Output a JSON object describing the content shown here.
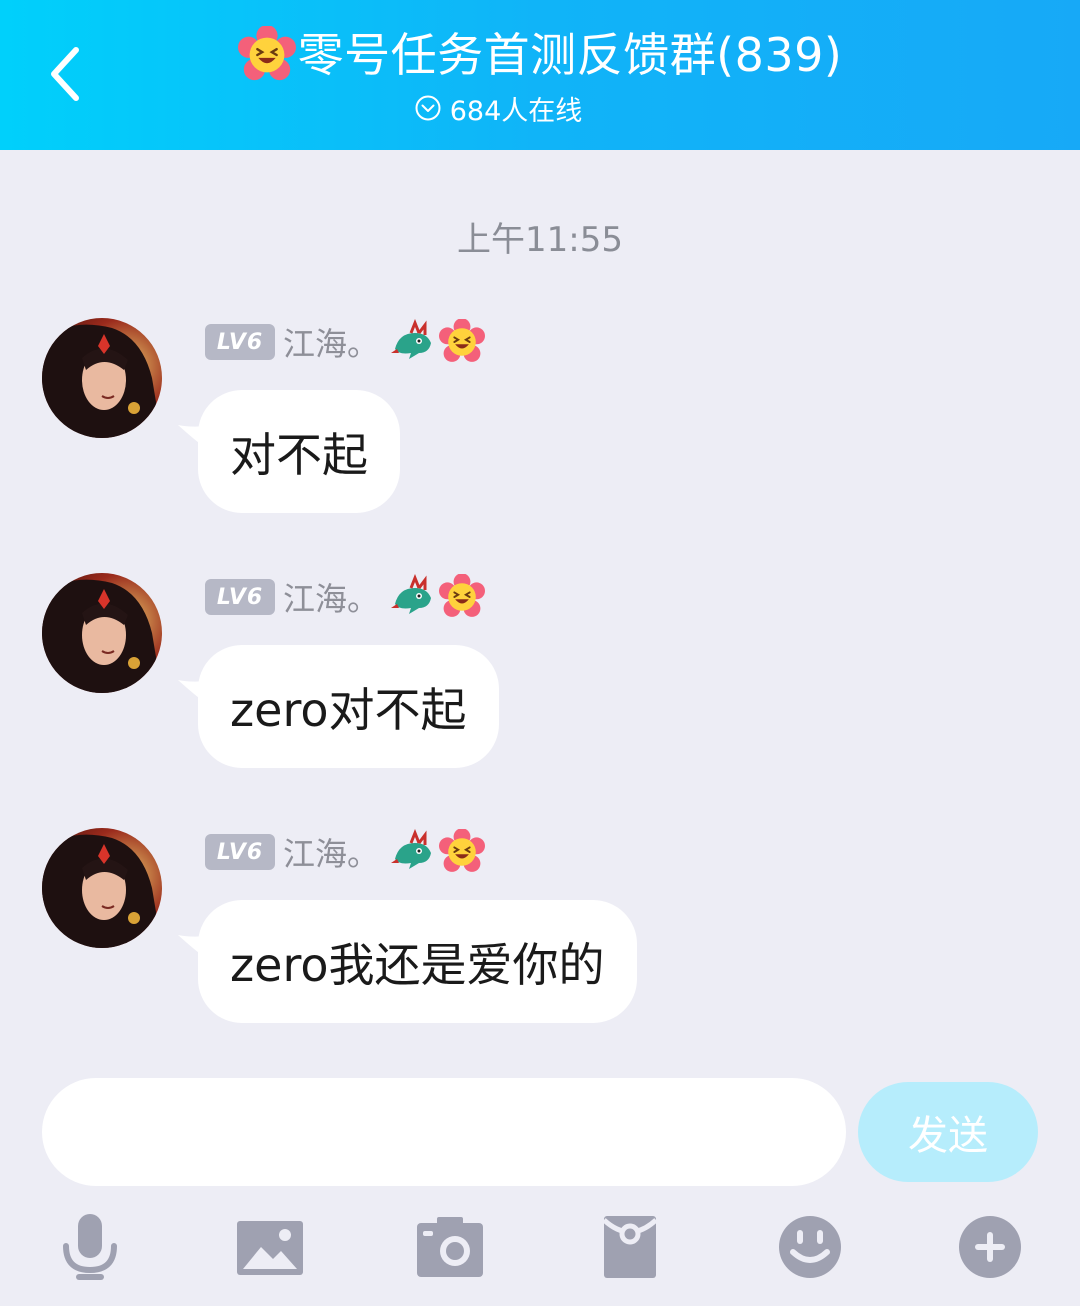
{
  "header": {
    "title": "零号任务首测反馈群(839)",
    "online_text": "684人在线",
    "background_color": "#10b4f8"
  },
  "timestamp": "上午11:55",
  "messages": [
    {
      "level": "LV6",
      "nickname": "江海。",
      "text": "对不起"
    },
    {
      "level": "LV6",
      "nickname": "江海。",
      "text": "zero对不起"
    },
    {
      "level": "LV6",
      "nickname": "江海。",
      "text": "zero我还是爱你的"
    }
  ],
  "composer": {
    "input_value": "",
    "send_label": "发送",
    "send_color": "#b6edfc"
  },
  "toolbar": {
    "icons": [
      "microphone-icon",
      "image-icon",
      "camera-icon",
      "red-packet-icon",
      "emoji-icon",
      "plus-icon"
    ],
    "icon_color": "#9fa1b1"
  }
}
